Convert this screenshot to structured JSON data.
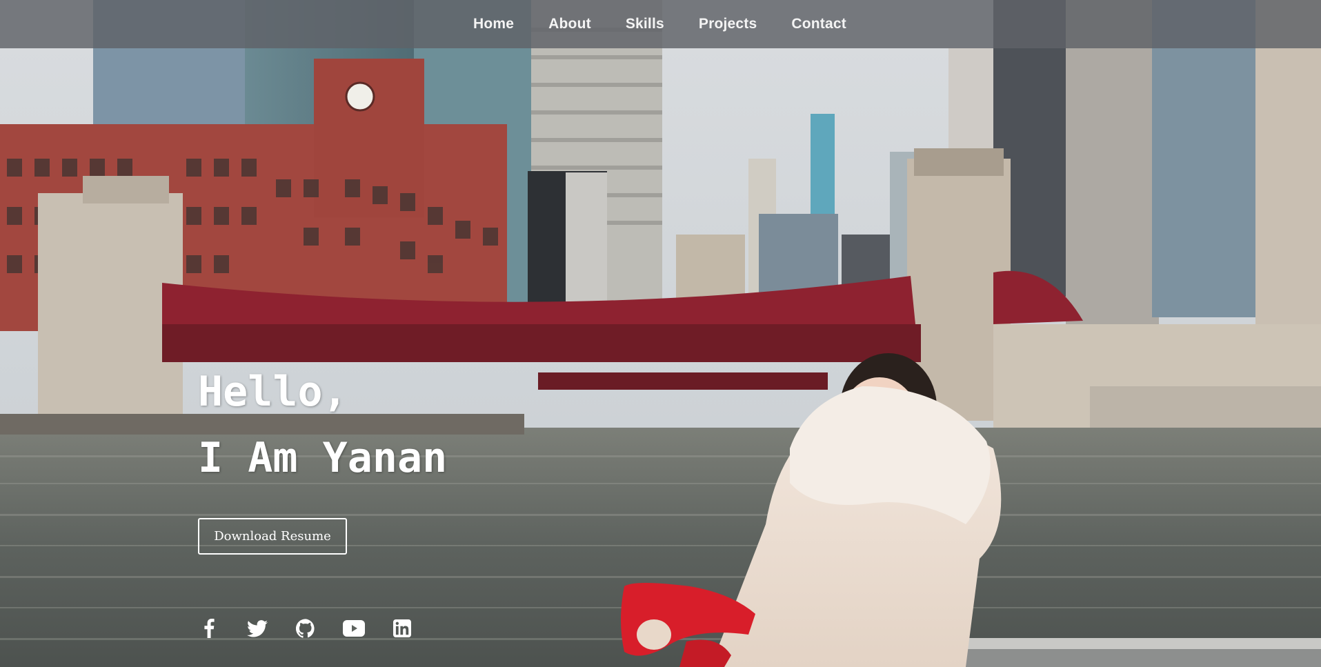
{
  "nav": {
    "items": [
      {
        "label": "Home"
      },
      {
        "label": "About"
      },
      {
        "label": "Skills"
      },
      {
        "label": "Projects"
      },
      {
        "label": "Contact"
      }
    ]
  },
  "hero": {
    "line1": "Hello,",
    "line2": "I Am Yanan",
    "resume_label": "Download Resume",
    "background_image": "photo of person in white fur-hooded coat and red mittens on Chicago riverwalk with red bridge and skyscrapers"
  },
  "social": [
    {
      "icon": "facebook-icon"
    },
    {
      "icon": "twitter-icon"
    },
    {
      "icon": "github-icon"
    },
    {
      "icon": "youtube-icon"
    },
    {
      "icon": "linkedin-icon"
    }
  ],
  "colors": {
    "nav_bg": "#5f6268",
    "text": "#ffffff",
    "bridge": "#8e2230",
    "brick": "#a2473f",
    "water": "#5f6663"
  }
}
